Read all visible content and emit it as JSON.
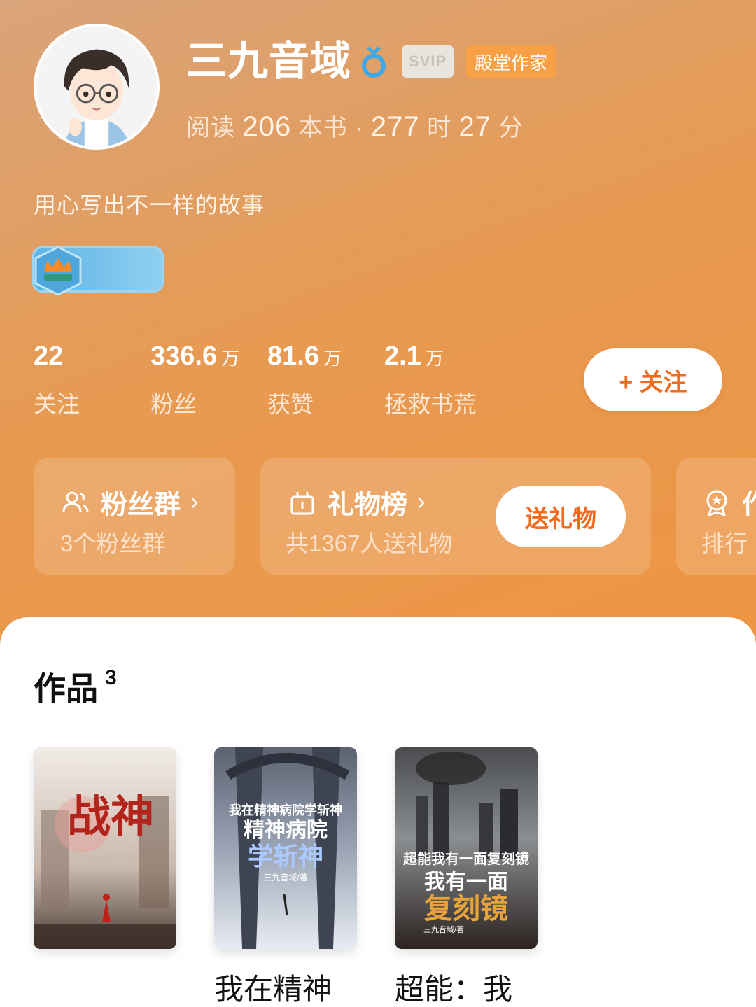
{
  "profile": {
    "name": "三九音域",
    "svip_label": "SVIP",
    "author_badge": "殿堂作家",
    "reading": {
      "prefix": "阅读",
      "books": "206",
      "books_unit": "本书 ·",
      "hours": "277",
      "hours_unit": "时",
      "minutes": "27",
      "minutes_unit": "分"
    },
    "bio": "用心写出不一样的故事"
  },
  "stats": [
    {
      "value": "22",
      "unit": "",
      "label": "关注"
    },
    {
      "value": "336.6",
      "unit": "万",
      "label": "粉丝"
    },
    {
      "value": "81.6",
      "unit": "万",
      "label": "获赞"
    },
    {
      "value": "2.1",
      "unit": "万",
      "label": "拯救书荒"
    }
  ],
  "follow_button": "+ 关注",
  "cards": {
    "fan_group": {
      "title": "粉丝群",
      "subtitle": "3个粉丝群"
    },
    "gift_board": {
      "title": "礼物榜",
      "subtitle": "共1367人送礼物",
      "button": "送礼物"
    },
    "ranking": {
      "title": "作",
      "subtitle": "排行"
    }
  },
  "works": {
    "title": "作品",
    "count": "3",
    "books": [
      {
        "title": "",
        "cover_text": "战神"
      },
      {
        "title": "我在精神",
        "cover_text": "我在精神病院学斩神",
        "cover_author": "三九音域/著"
      },
      {
        "title": "超能：我",
        "cover_text": "超能我有一面复刻镜",
        "cover_author": "三九音域/著"
      }
    ]
  },
  "colors": {
    "header_gradient": [
      "#d9a47a",
      "#ee9440"
    ],
    "accent": "#f26a1c"
  }
}
